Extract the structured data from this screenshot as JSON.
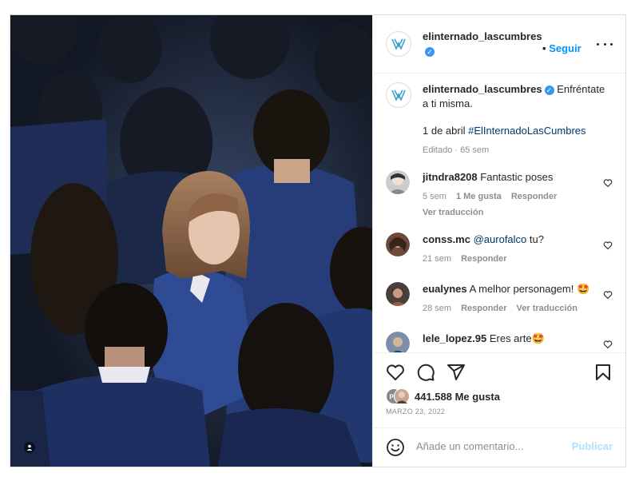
{
  "post": {
    "username": "elinternado_lascumbres",
    "follow_label": "Seguir",
    "more_icon": "more-horizontal-icon",
    "verified_icon": "verified-badge-icon"
  },
  "caption": {
    "username": "elinternado_lascumbres",
    "text": "Enfréntate a ti misma.",
    "line2_prefix": "1 de abril ",
    "hashtag": "#ElInternadoLasCumbres",
    "meta": "Editado · 65 sem"
  },
  "comments": [
    {
      "username": "jitndra8208",
      "text": "Fantastic poses",
      "time": "5 sem",
      "likes": "1 Me gusta",
      "reply": "Responder",
      "translate": "Ver traducción"
    },
    {
      "username": "conss.mc",
      "mention": "@aurofalco",
      "text": " tu?",
      "time": "21 sem",
      "reply": "Responder"
    },
    {
      "username": "eualynes",
      "text": "A melhor personagem! 🤩",
      "time": "28 sem",
      "reply": "Responder",
      "translate": "Ver traducción"
    },
    {
      "username": "lele_lopez.95",
      "text": "Eres arte🤩"
    }
  ],
  "actions": {
    "like_icon": "heart-icon",
    "comment_icon": "comment-icon",
    "share_icon": "send-icon",
    "save_icon": "bookmark-icon",
    "likes_count": "441.588 Me gusta",
    "date": "MARZO 23, 2022"
  },
  "composer": {
    "emoji_icon": "emoji-icon",
    "placeholder": "Añade un comentario...",
    "publish_label": "Publicar"
  },
  "colors": {
    "accent": "#0095f6",
    "verified": "#3897f0",
    "publish_disabled": "#b2dffc",
    "logo": "#3aa0c8"
  }
}
